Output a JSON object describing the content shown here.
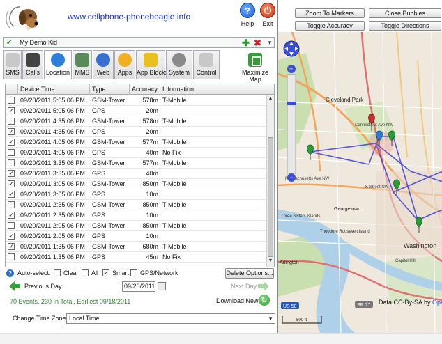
{
  "header": {
    "site_url": "www.cellphone-phonebeagle.info",
    "help_label": "Help",
    "exit_label": "Exit"
  },
  "kid_selector": {
    "name": "My Demo Kid"
  },
  "tabs": [
    {
      "label": "SMS",
      "icon": "envelope-icon",
      "color": "#c8c8c8"
    },
    {
      "label": "Calls",
      "icon": "phone-icon",
      "color": "#444444"
    },
    {
      "label": "Location",
      "icon": "globe-icon",
      "color": "#2f7fd8",
      "active": true
    },
    {
      "label": "MMS",
      "icon": "picture-icon",
      "color": "#5a8a5a"
    },
    {
      "label": "Web",
      "icon": "web-globe-icon",
      "color": "#3a6fd0"
    },
    {
      "label": "Apps",
      "icon": "apps-icon",
      "color": "#f0b020"
    },
    {
      "label": "App Blocks",
      "icon": "app-blocks-icon",
      "color": "#e8c020"
    },
    {
      "label": "System",
      "icon": "gear-icon",
      "color": "#8a8a8a"
    },
    {
      "label": "Control",
      "icon": "control-icon",
      "color": "#c8c8c8"
    }
  ],
  "maximize_label": "Maximize Map",
  "table": {
    "columns": [
      "Device Time",
      "Type",
      "Accuracy",
      "Information"
    ],
    "rows": [
      {
        "checked": false,
        "time": "09/20/2011 5:05:06 PM",
        "type": "GSM-Tower",
        "accuracy": "578m",
        "info": "T-Mobile"
      },
      {
        "checked": true,
        "time": "09/20/2011 5:05:06 PM",
        "type": "GPS",
        "accuracy": "20m",
        "info": ""
      },
      {
        "checked": false,
        "time": "09/20/2011 4:35:06 PM",
        "type": "GSM-Tower",
        "accuracy": "578m",
        "info": "T-Mobile"
      },
      {
        "checked": true,
        "time": "09/20/2011 4:35:06 PM",
        "type": "GPS",
        "accuracy": "20m",
        "info": ""
      },
      {
        "checked": true,
        "time": "09/20/2011 4:05:06 PM",
        "type": "GSM-Tower",
        "accuracy": "577m",
        "info": "T-Mobile"
      },
      {
        "checked": false,
        "time": "09/20/2011 4:05:06 PM",
        "type": "GPS",
        "accuracy": "40m",
        "info": "No Fix"
      },
      {
        "checked": false,
        "time": "09/20/2011 3:35:06 PM",
        "type": "GSM-Tower",
        "accuracy": "577m",
        "info": "T-Mobile"
      },
      {
        "checked": true,
        "time": "09/20/2011 3:35:06 PM",
        "type": "GPS",
        "accuracy": "40m",
        "info": ""
      },
      {
        "checked": true,
        "time": "09/20/2011 3:05:06 PM",
        "type": "GSM-Tower",
        "accuracy": "850m",
        "info": "T-Mobile"
      },
      {
        "checked": true,
        "time": "09/20/2011 3:05:06 PM",
        "type": "GPS",
        "accuracy": "10m",
        "info": ""
      },
      {
        "checked": false,
        "time": "09/20/2011 2:35:06 PM",
        "type": "GSM-Tower",
        "accuracy": "850m",
        "info": "T-Mobile"
      },
      {
        "checked": true,
        "time": "09/20/2011 2:35:06 PM",
        "type": "GPS",
        "accuracy": "10m",
        "info": ""
      },
      {
        "checked": false,
        "time": "09/20/2011 2:05:06 PM",
        "type": "GSM-Tower",
        "accuracy": "850m",
        "info": "T-Mobile"
      },
      {
        "checked": true,
        "time": "09/20/2011 2:05:06 PM",
        "type": "GPS",
        "accuracy": "10m",
        "info": ""
      },
      {
        "checked": true,
        "time": "09/20/2011 1:35:06 PM",
        "type": "GSM-Tower",
        "accuracy": "680m",
        "info": "T-Mobile"
      },
      {
        "checked": false,
        "time": "09/20/2011 1:35:06 PM",
        "type": "GPS",
        "accuracy": "45m",
        "info": "No Fix"
      }
    ]
  },
  "autoselect": {
    "label": "Auto-select:",
    "options": [
      {
        "label": "Clear",
        "checked": false
      },
      {
        "label": "All",
        "checked": false
      },
      {
        "label": "Smart",
        "checked": true
      },
      {
        "label": "GPS/Network",
        "checked": false
      }
    ],
    "delete_label": "Delete Options..."
  },
  "navigation": {
    "prev_label": "Previous Day",
    "date_value": "09/20/2011",
    "next_label": "Next Day"
  },
  "events_label": "70 Events. 230 In Total, Earliest 09/18/2011",
  "download_label": "Download New",
  "timezone": {
    "label": "Change Time Zone",
    "value": "Local Time"
  },
  "map": {
    "buttons": {
      "zoom_markers": "Zoom To Markers",
      "close_bubbles": "Close Bubbles",
      "toggle_accuracy": "Toggle Accuracy",
      "toggle_directions": "Toggle Directions"
    },
    "attribution_prefix": "Data CC-By-SA by ",
    "attribution_link": "Ope",
    "labels": {
      "cleveland_park": "Cleveland Park",
      "washington": "Washington",
      "georgetown": "Georgetown",
      "arlington": "Arlington",
      "three_sisters": "Three Sisters Islands",
      "theodore": "Theodore Roosevelt Island",
      "capitol_hill": "Capitol Hill",
      "road_1": "Connecticut Ave NW",
      "road_2": "Massachusetts Ave NW",
      "road_3": "K Street NW"
    },
    "shield_us50": "US 50",
    "shield_sr27": "SR 27",
    "scale_label": "500 ft"
  }
}
